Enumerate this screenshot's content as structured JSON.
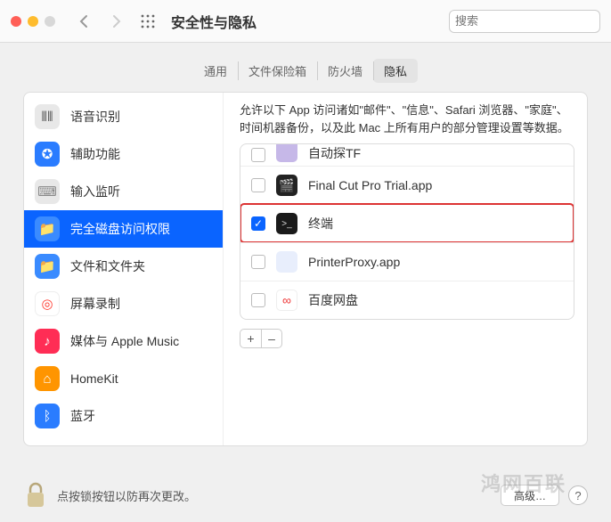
{
  "window": {
    "title": "安全性与隐私"
  },
  "search": {
    "placeholder": "搜索"
  },
  "tabs": [
    {
      "label": "通用",
      "active": false
    },
    {
      "label": "文件保险箱",
      "active": false
    },
    {
      "label": "防火墙",
      "active": false
    },
    {
      "label": "隐私",
      "active": true
    }
  ],
  "sidebar": {
    "items": [
      {
        "label": "语音识别",
        "icon": "soundwave",
        "bg": "#e8e8e8",
        "fg": "#555"
      },
      {
        "label": "辅助功能",
        "icon": "accessibility",
        "bg": "#2a7cff",
        "fg": "#fff"
      },
      {
        "label": "输入监听",
        "icon": "keyboard",
        "bg": "#e8e8e8",
        "fg": "#555"
      },
      {
        "label": "完全磁盘访问权限",
        "icon": "folder",
        "bg": "#3a8bff",
        "fg": "#fff",
        "selected": true
      },
      {
        "label": "文件和文件夹",
        "icon": "folder",
        "bg": "#3a8bff",
        "fg": "#fff"
      },
      {
        "label": "屏幕录制",
        "icon": "record",
        "bg": "#ff3b30",
        "fg": "#fff"
      },
      {
        "label": "媒体与 Apple Music",
        "icon": "music",
        "bg": "#ff2d55",
        "fg": "#fff"
      },
      {
        "label": "HomeKit",
        "icon": "home",
        "bg": "#ff9500",
        "fg": "#fff"
      },
      {
        "label": "蓝牙",
        "icon": "bluetooth",
        "bg": "#2a7cff",
        "fg": "#fff"
      }
    ]
  },
  "content": {
    "description": "允许以下 App 访问诸如\"邮件\"、\"信息\"、Safari 浏览器、\"家庭\"、时间机器备份，以及此 Mac 上所有用户的部分管理设置等数据。",
    "apps": [
      {
        "label": "自动探TF",
        "checked": false,
        "iconBg": "#c6b8e8",
        "partial": true
      },
      {
        "label": "Final Cut Pro Trial.app",
        "checked": false,
        "iconBg": "#222",
        "iconEmoji": "🎬"
      },
      {
        "label": "终端",
        "checked": true,
        "iconBg": "#1a1a1a",
        "iconText": ">_",
        "highlighted": true
      },
      {
        "label": "PrinterProxy.app",
        "checked": false,
        "iconBg": "#e8eefc"
      },
      {
        "label": "百度网盘",
        "checked": false,
        "iconBg": "#fff",
        "iconEmoji": "🔗"
      }
    ],
    "add": "+",
    "remove": "–"
  },
  "footer": {
    "lockText": "点按锁按钮以防再次更改。",
    "advanced": "高级…",
    "help": "?"
  },
  "watermark": "鸿网百联",
  "colors": {
    "accent": "#0a64ff",
    "highlight": "#d33"
  }
}
